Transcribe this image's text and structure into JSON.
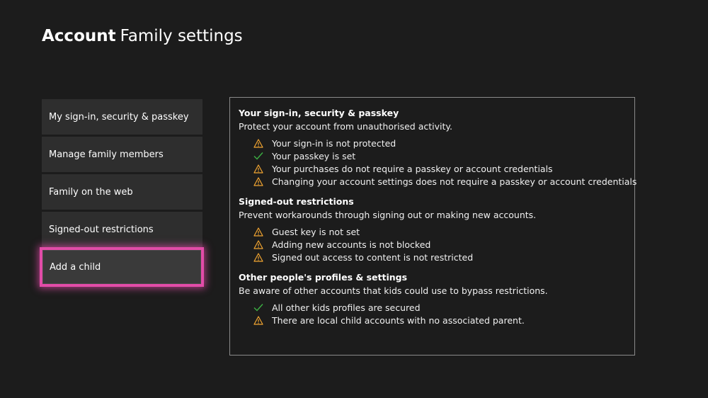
{
  "header": {
    "title_bold": "Account",
    "title_rest": "Family settings"
  },
  "menu": [
    {
      "label": "My sign-in, security & passkey"
    },
    {
      "label": "Manage family members"
    },
    {
      "label": "Family on the web"
    },
    {
      "label": "Signed-out restrictions"
    },
    {
      "label": "Add a child"
    }
  ],
  "colors": {
    "focus": "#e24ca8",
    "warning": "#f2a531",
    "check": "#3cb043"
  },
  "sections": [
    {
      "title": "Your sign-in, security & passkey",
      "description": "Protect your account from unauthorised activity.",
      "items": [
        {
          "icon": "warning-icon",
          "text": "Your sign-in is not protected"
        },
        {
          "icon": "check-icon",
          "text": "Your passkey is set"
        },
        {
          "icon": "warning-icon",
          "text": "Your purchases do not require a passkey or account credentials"
        },
        {
          "icon": "warning-icon",
          "text": "Changing your account settings does not require a passkey or account credentials"
        }
      ]
    },
    {
      "title": "Signed-out restrictions",
      "description": "Prevent workarounds through signing out or making new accounts.",
      "items": [
        {
          "icon": "warning-icon",
          "text": "Guest key is not set"
        },
        {
          "icon": "warning-icon",
          "text": "Adding new accounts is not blocked"
        },
        {
          "icon": "warning-icon",
          "text": "Signed out access to content is not restricted"
        }
      ]
    },
    {
      "title": "Other people's profiles & settings",
      "description": "Be aware of other accounts that kids could use to bypass restrictions.",
      "items": [
        {
          "icon": "check-icon",
          "text": "All other kids profiles are secured"
        },
        {
          "icon": "warning-icon",
          "text": "There are local child accounts with no associated parent."
        }
      ]
    }
  ]
}
